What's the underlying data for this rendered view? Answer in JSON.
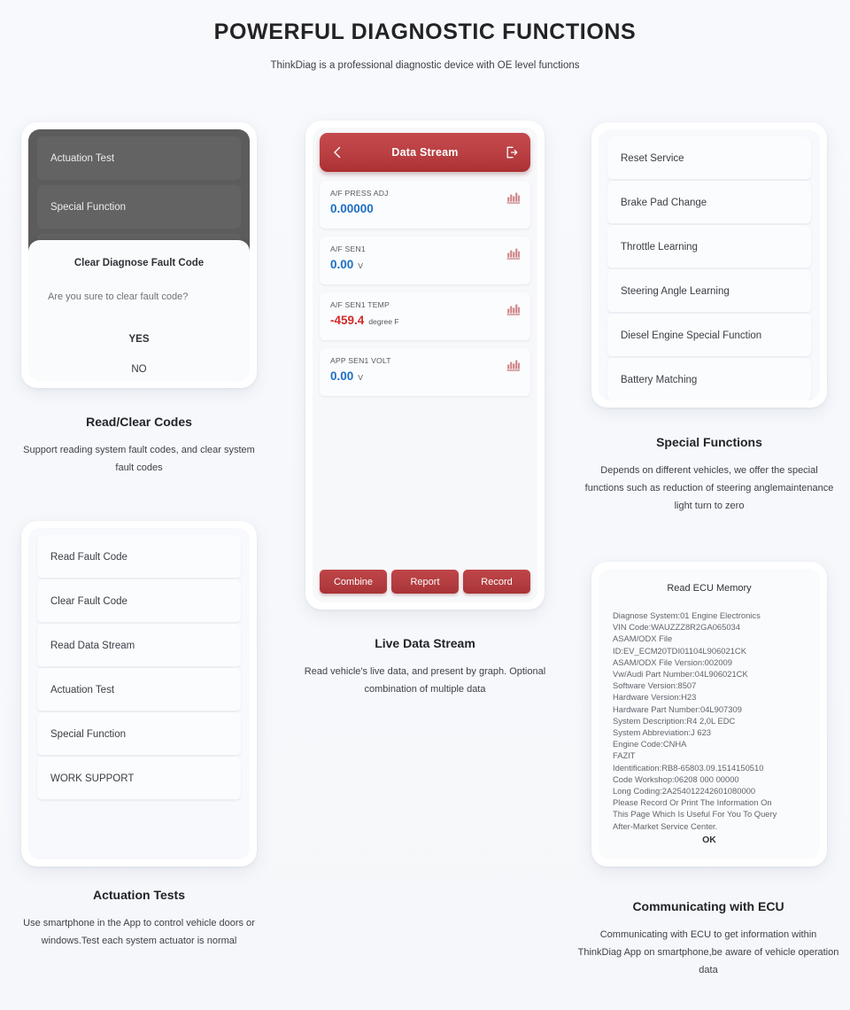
{
  "header": {
    "title": "POWERFUL DIAGNOSTIC FUNCTIONS",
    "subtitle": "ThinkDiag is a professional diagnostic device with OE level functions"
  },
  "colors": {
    "page_bg": "#f7f9fc",
    "accent_red": "#b93f42",
    "value_blue": "#1d6fc4",
    "value_red": "#d32a2a",
    "dark_panel": "#5c5c5c"
  },
  "read_clear_card": {
    "dark_items": [
      "Actuation Test",
      "Special Function"
    ],
    "dialog": {
      "title": "Clear Diagnose Fault Code",
      "message": "Are you sure to clear fault code?",
      "confirm_label": "YES",
      "cancel_label": "NO"
    }
  },
  "data_stream_card": {
    "back_icon": "chevron-left-icon",
    "title": "Data Stream",
    "exit_icon": "exit-icon",
    "row_icon": "bar-chart-icon",
    "items": [
      {
        "label": "A/F PRESS ADJ",
        "value": "0.00000",
        "unit": "",
        "value_color": "blue"
      },
      {
        "label": "A/F SEN1",
        "value": "0.00",
        "unit": "V",
        "value_color": "blue"
      },
      {
        "label": "A/F SEN1 TEMP",
        "value": "-459.4",
        "unit": "degree F",
        "value_color": "red"
      },
      {
        "label": "APP SEN1 VOLT",
        "value": "0.00",
        "unit": "V",
        "value_color": "blue"
      }
    ],
    "buttons": [
      "Combine",
      "Report",
      "Record"
    ]
  },
  "special_functions_card": {
    "items": [
      "Reset Service",
      "Brake Pad Change",
      "Throttle Learning",
      "Steering Angle Learning",
      "Diesel Engine Special Function",
      "Battery Matching"
    ]
  },
  "actuation_card": {
    "items": [
      "Read Fault Code",
      "Clear Fault Code",
      "Read Data Stream",
      "Actuation Test",
      "Special Function",
      "WORK SUPPORT"
    ]
  },
  "ecu_card": {
    "title": "Read ECU Memory",
    "lines": [
      "Diagnose System:01 Engine Electronics",
      "VIN Code:WAUZZZ8R2GA065034",
      "ASAM/ODX File",
      "ID:EV_ECM20TDI01104L906021CK",
      "ASAM/ODX File Version:002009",
      "Vw/Audi Part Number:04L906021CK",
      "Software Version:8507",
      "Hardware Version:H23",
      "Hardware Part Number:04L907309",
      "System Description:R4 2,0L EDC",
      "System Abbreviation:J 623",
      "Engine Code:CNHA",
      "FAZIT",
      "Identification:RB8-65803.09.1514150510",
      "Code Workshop:06208  000  00000",
      "Long Coding:2A254012242601080000",
      "Please Record Or Print The Information On",
      "This Page Which Is Useful For You To Query",
      "After-Market Service Center."
    ],
    "ok_label": "OK"
  },
  "captions": {
    "read_clear": {
      "title": "Read/Clear Codes",
      "desc": "Support reading system fault codes, and clear system fault codes"
    },
    "special": {
      "title": "Special Functions",
      "desc": "Depends on different vehicles, we offer the special functions such as reduction of steering anglemaintenance light turn to zero"
    },
    "live_data": {
      "title": "Live Data Stream",
      "desc": "Read vehicle's live data, and present by graph. Optional combination of multiple data"
    },
    "actuation": {
      "title": "Actuation Tests",
      "desc": "Use smartphone in the App to control vehicle doors or windows.Test each system actuator is normal"
    },
    "ecu": {
      "title": "Communicating with ECU",
      "desc": "Communicating with ECU to get information within ThinkDiag App on smartphone,be aware of vehicle operation data"
    }
  }
}
